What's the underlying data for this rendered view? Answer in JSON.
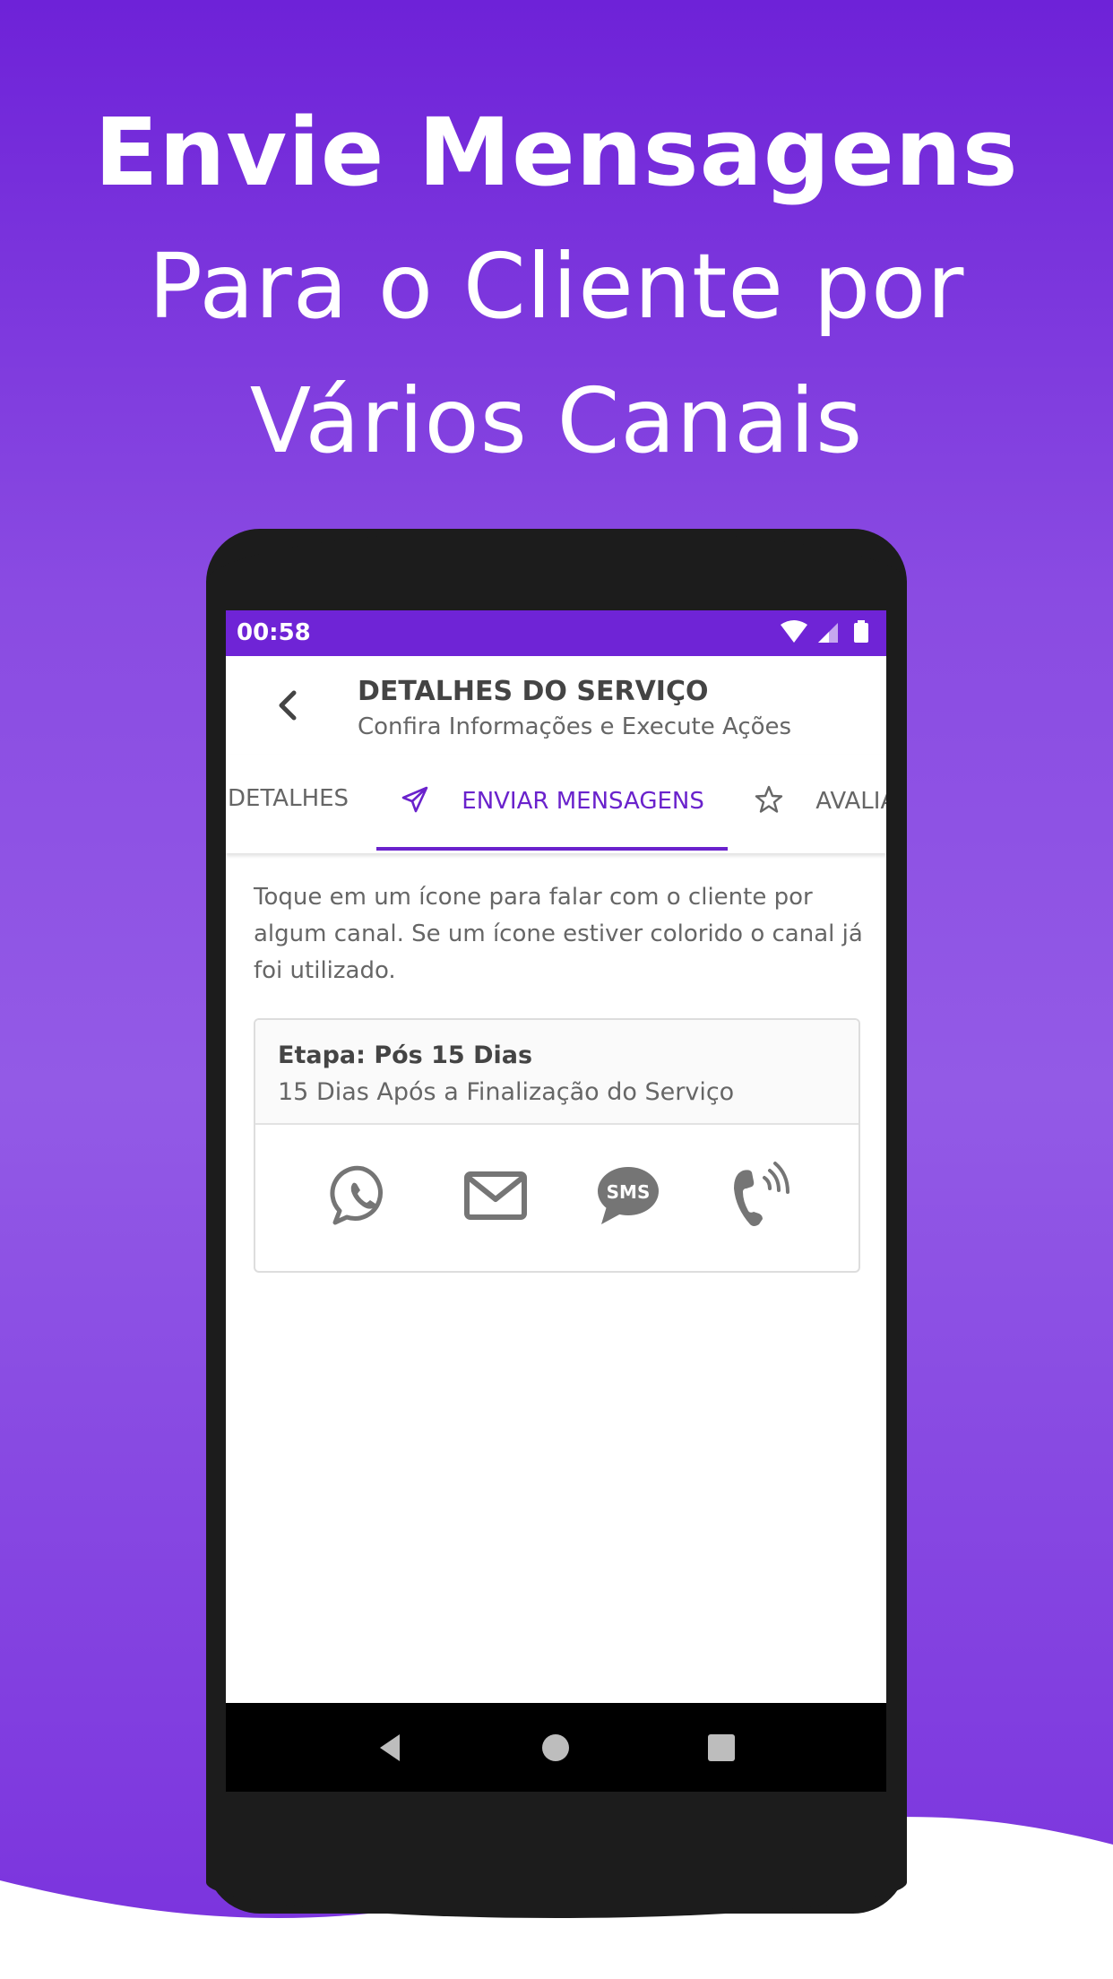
{
  "headline": {
    "line1": "Envie Mensagens",
    "line2": "Para o Cliente por",
    "line3": "Vários Canais"
  },
  "status_bar": {
    "time": "00:58",
    "icons": [
      "wifi-icon",
      "signal-icon",
      "battery-icon"
    ]
  },
  "app_bar": {
    "back_icon": "chevron-left-icon",
    "title": "DETALHES DO SERVIÇO",
    "subtitle": "Confira Informações e Execute Ações"
  },
  "tabs": [
    {
      "label": "DETALHES",
      "icon": "",
      "active": false
    },
    {
      "label": "ENVIAR MENSAGENS",
      "icon": "paper-plane-icon",
      "active": true
    },
    {
      "label": "AVALIAÇÃO",
      "icon": "star-icon",
      "active": false
    }
  ],
  "instructions": "Toque em um ícone para falar com o cliente por algum canal. Se um ícone estiver colorido o canal já foi utilizado.",
  "stage": {
    "title": "Etapa: Pós 15 Dias",
    "description": "15 Dias Após a Finalização do Serviço",
    "channels": [
      {
        "name": "whatsapp",
        "icon": "whatsapp-icon"
      },
      {
        "name": "email",
        "icon": "envelope-icon"
      },
      {
        "name": "sms",
        "icon": "sms-bubble-icon",
        "text": "SMS"
      },
      {
        "name": "phone",
        "icon": "phone-call-icon"
      }
    ]
  },
  "nav_bar": {
    "icons": [
      "nav-back-icon",
      "nav-home-icon",
      "nav-recents-icon"
    ]
  },
  "colors": {
    "accent": "#6a22cc",
    "status_bar": "#6f24d6",
    "icon_gray": "#757575"
  }
}
